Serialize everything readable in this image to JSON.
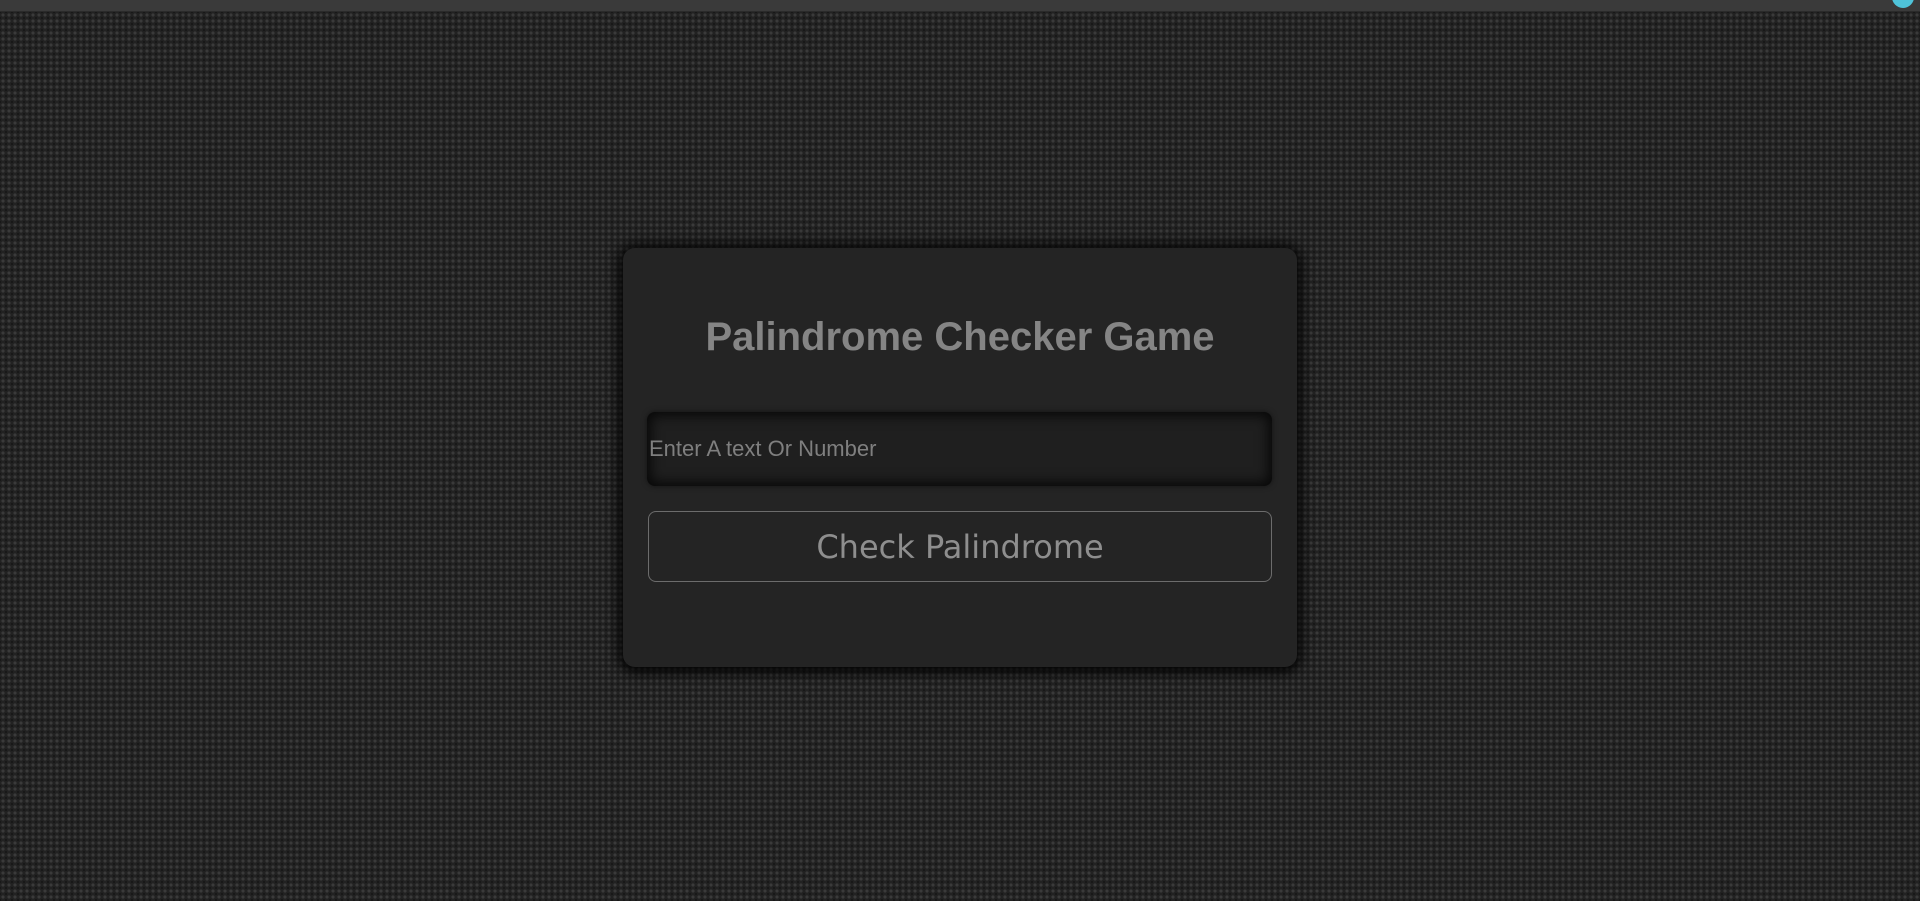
{
  "app": {
    "title": "Palindrome Checker Game"
  },
  "input": {
    "value": "",
    "placeholder": "Enter A text Or Number"
  },
  "button": {
    "label": "Check Palindrome"
  },
  "colors": {
    "background": "#222222",
    "card": "#242424",
    "text": "#858585",
    "accent": "#4fc3d9"
  }
}
